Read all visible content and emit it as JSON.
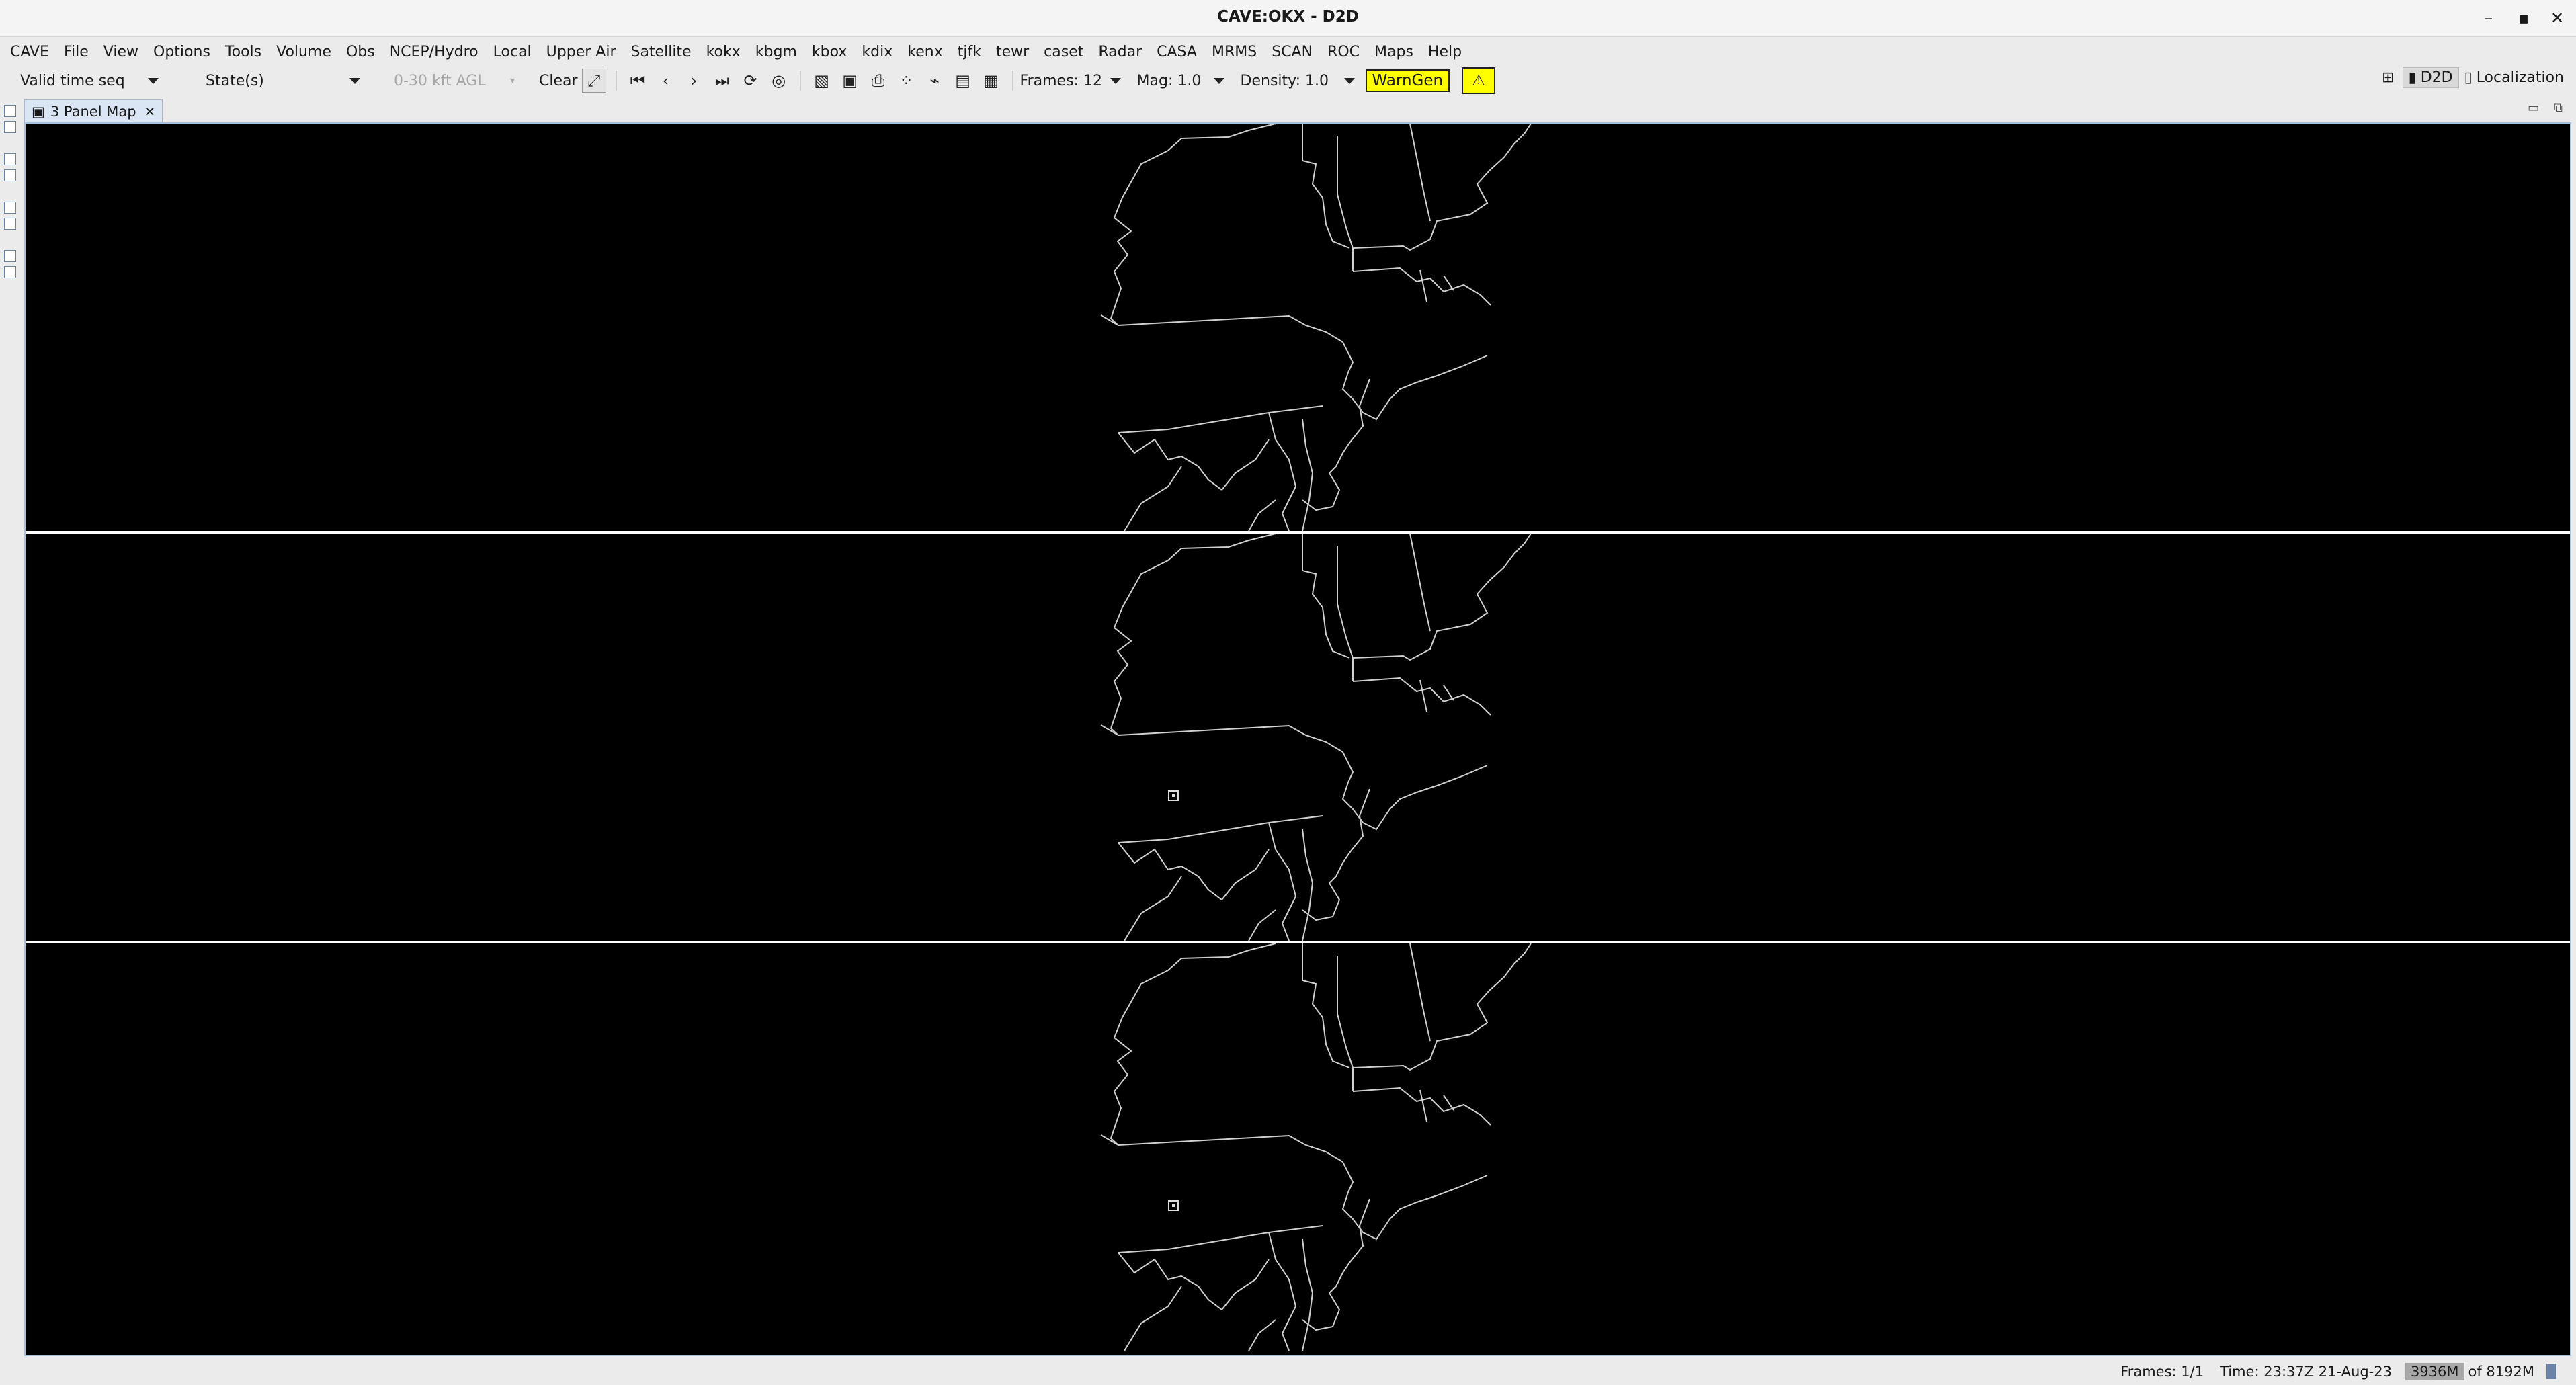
{
  "window": {
    "title": "CAVE:OKX - D2D",
    "minimize": "–",
    "maximize": "▪",
    "close": "✕"
  },
  "menu": [
    "CAVE",
    "File",
    "View",
    "Options",
    "Tools",
    "Volume",
    "Obs",
    "NCEP/Hydro",
    "Local",
    "Upper Air",
    "Satellite",
    "kokx",
    "kbgm",
    "kbox",
    "kdix",
    "kenx",
    "tjfk",
    "tewr",
    "caset",
    "Radar",
    "CASA",
    "MRMS",
    "SCAN",
    "ROC",
    "Maps",
    "Help"
  ],
  "toolbar": {
    "time_mode": "Valid time seq",
    "states": "State(s)",
    "height": "0-30 kft AGL",
    "clear": "Clear",
    "frames": "Frames: 12",
    "mag": "Mag: 1.0",
    "density": "Density: 1.0",
    "warngen": "WarnGen"
  },
  "perspectives": {
    "d2d": "D2D",
    "localization": "Localization"
  },
  "tab": {
    "label": "3 Panel Map"
  },
  "status": {
    "frames": "Frames: 1/1",
    "time": "Time: 23:37Z 21-Aug-23",
    "mem_used": "3936M",
    "mem_total": "of 8192M"
  },
  "colors": {
    "map_bg": "#000000",
    "boundary": "#d0d0d0",
    "warngen": "#ffff00",
    "frame_border": "#a9c2e0"
  },
  "icons": [
    "first-frame-icon",
    "prev-frame-icon",
    "next-frame-icon",
    "last-frame-icon",
    "loop-icon",
    "loop-props-icon",
    "image-combo-icon",
    "properties-icon",
    "print-icon",
    "points-icon",
    "baselines-icon",
    "pane-layout-icon",
    "single-pane-icon"
  ]
}
